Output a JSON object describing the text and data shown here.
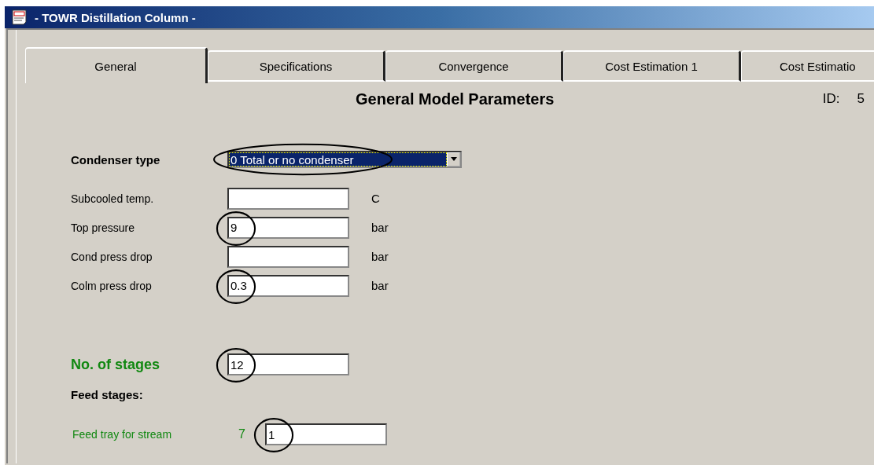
{
  "window": {
    "title": "- TOWR Distillation Column -"
  },
  "tabs": [
    {
      "label": "General",
      "selected": true
    },
    {
      "label": "Specifications",
      "selected": false
    },
    {
      "label": "Convergence",
      "selected": false
    },
    {
      "label": "Cost Estimation 1",
      "selected": false
    },
    {
      "label": "Cost Estimatio",
      "selected": false
    }
  ],
  "heading": "General Model Parameters",
  "id_label": "ID:",
  "id_value": "5",
  "condenser": {
    "label": "Condenser type",
    "value": "0 Total or no condenser",
    "circled": true
  },
  "params": [
    {
      "label": "Subcooled temp.",
      "unit": "C",
      "circled": false
    },
    {
      "label": "Top pressure",
      "value": "9",
      "unit": "bar",
      "circled": true
    },
    {
      "label": "Cond press drop",
      "unit": "bar",
      "circled": false
    },
    {
      "label": "Colm press drop",
      "value": "0.3",
      "unit": "bar",
      "circled": true
    }
  ],
  "stages": {
    "label": "No. of stages",
    "value": "12",
    "circled": true
  },
  "feed_heading": "Feed stages:",
  "feeds": [
    {
      "label": "Feed tray for stream",
      "stream": "7",
      "value": "1",
      "circled": true
    }
  ]
}
